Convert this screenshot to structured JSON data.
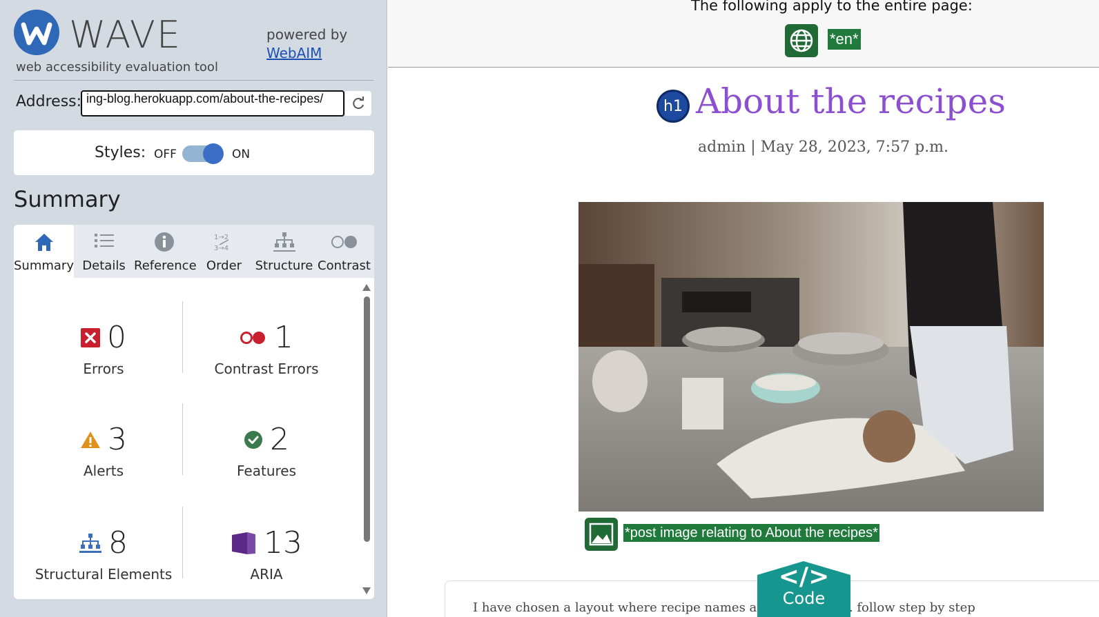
{
  "sidebar": {
    "brand": "WAVE",
    "tagline": "web accessibility evaluation tool",
    "powered_by": "powered by",
    "powered_link": "WebAIM",
    "address_label": "Address:",
    "address_value": "ing-blog.herokuapp.com/about-the-recipes/",
    "styles_label": "Styles:",
    "styles_off": "OFF",
    "styles_on": "ON",
    "styles_enabled": true,
    "summary_heading": "Summary",
    "tabs": [
      {
        "label": "Summary",
        "icon": "home-icon",
        "active": true
      },
      {
        "label": "Details",
        "icon": "list-icon",
        "active": false
      },
      {
        "label": "Reference",
        "icon": "info-icon",
        "active": false
      },
      {
        "label": "Order",
        "icon": "order-icon",
        "active": false
      },
      {
        "label": "Structure",
        "icon": "structure-icon",
        "active": false
      },
      {
        "label": "Contrast",
        "icon": "contrast-icon",
        "active": false
      }
    ],
    "stats": {
      "errors": {
        "count": "0",
        "label": "Errors",
        "icon": "error-icon"
      },
      "contrast_errors": {
        "count": "1",
        "label": "Contrast Errors",
        "icon": "contrast-error-icon"
      },
      "alerts": {
        "count": "3",
        "label": "Alerts",
        "icon": "alert-icon"
      },
      "features": {
        "count": "2",
        "label": "Features",
        "icon": "feature-icon"
      },
      "structural": {
        "count": "8",
        "label": "Structural Elements",
        "icon": "structure-icon"
      },
      "aria": {
        "count": "13",
        "label": "ARIA",
        "icon": "aria-icon"
      }
    }
  },
  "page": {
    "banner_text": "The following apply to the entire page:",
    "language_badge": "*en*",
    "heading_badge": "h1",
    "title": "About the recipes",
    "meta": "admin | May 28, 2023, 7:57 p.m.",
    "image_alt_badge": "*post image relating to About the recipes*",
    "content_snippet": "I have chosen a layout where recipe names are clear with ... follow step by step",
    "code_button": "Code",
    "code_symbol": "</>"
  },
  "colors": {
    "wave_blue": "#2f68b7",
    "title_purple": "#8c4fcf",
    "feature_green": "#1f7a3c",
    "error_red": "#c8202f",
    "alert_orange": "#e0901c",
    "aria_purple": "#5b2a86",
    "code_teal": "#17968f"
  }
}
